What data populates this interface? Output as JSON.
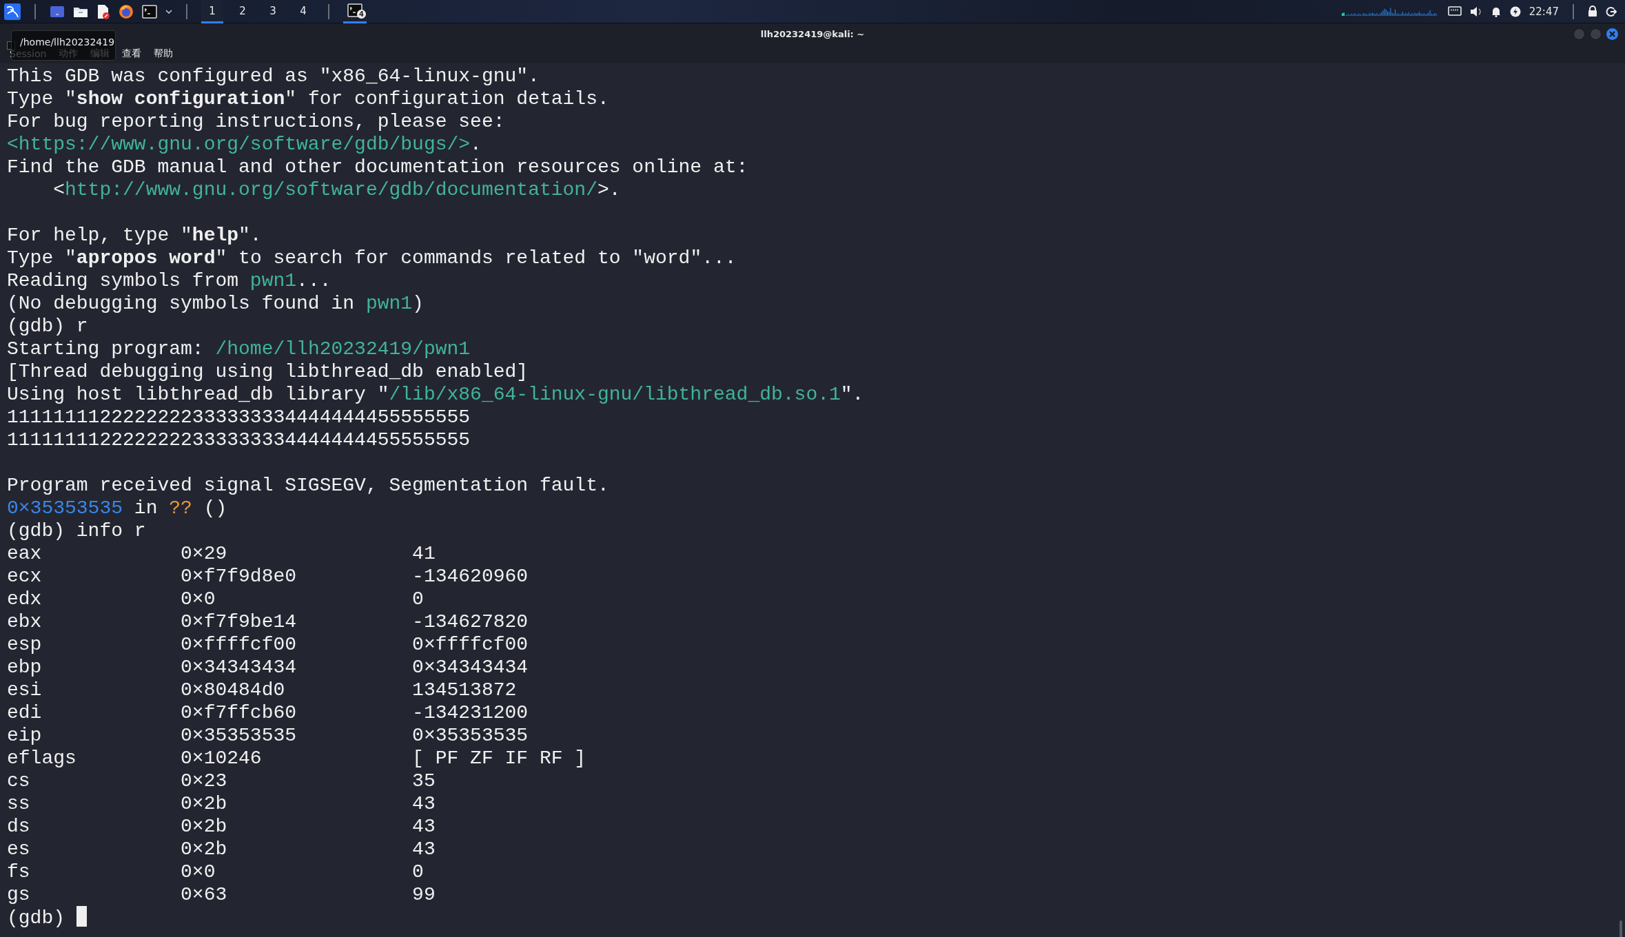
{
  "taskbar": {
    "workspaces": [
      {
        "label": "1",
        "selected": true
      },
      {
        "label": "2",
        "selected": false
      },
      {
        "label": "3",
        "selected": false
      },
      {
        "label": "4",
        "selected": false
      }
    ],
    "task": {
      "badge": "4",
      "selected": true
    },
    "clock": "22:47"
  },
  "window": {
    "title": "llh20232419@kali: ~",
    "tooltip": "/home/llh20232419",
    "menu": [
      "Session",
      "动作",
      "编辑",
      "查看",
      "帮助"
    ]
  },
  "terminal": {
    "lines": [
      {
        "kind": "text",
        "segments": [
          {
            "kind": "plain",
            "text": "This GDB was configured as \"x86_64-linux-gnu\"."
          }
        ]
      },
      {
        "kind": "text",
        "segments": [
          {
            "kind": "plain",
            "text": "Type \""
          },
          {
            "kind": "bold",
            "text": "show configuration"
          },
          {
            "kind": "plain",
            "text": "\" for configuration details."
          }
        ]
      },
      {
        "kind": "text",
        "segments": [
          {
            "kind": "plain",
            "text": "For bug reporting instructions, please see:"
          }
        ]
      },
      {
        "kind": "text",
        "segments": [
          {
            "kind": "url",
            "text": "<https://www.gnu.org/software/gdb/bugs/>"
          },
          {
            "kind": "plain",
            "text": "."
          }
        ]
      },
      {
        "kind": "text",
        "segments": [
          {
            "kind": "plain",
            "text": "Find the GDB manual and other documentation resources online at:"
          }
        ]
      },
      {
        "kind": "text",
        "segments": [
          {
            "kind": "plain",
            "text": "    <"
          },
          {
            "kind": "url",
            "text": "http://www.gnu.org/software/gdb/documentation/"
          },
          {
            "kind": "plain",
            "text": ">."
          }
        ]
      },
      {
        "kind": "blank"
      },
      {
        "kind": "text",
        "segments": [
          {
            "kind": "plain",
            "text": "For help, type \""
          },
          {
            "kind": "bold",
            "text": "help"
          },
          {
            "kind": "plain",
            "text": "\"."
          }
        ]
      },
      {
        "kind": "text",
        "segments": [
          {
            "kind": "plain",
            "text": "Type \""
          },
          {
            "kind": "bold",
            "text": "apropos word"
          },
          {
            "kind": "plain",
            "text": "\" to search for commands related to \"word\"..."
          }
        ]
      },
      {
        "kind": "text",
        "segments": [
          {
            "kind": "plain",
            "text": "Reading symbols from "
          },
          {
            "kind": "url",
            "text": "pwn1"
          },
          {
            "kind": "plain",
            "text": "..."
          }
        ]
      },
      {
        "kind": "text",
        "segments": [
          {
            "kind": "plain",
            "text": "(No debugging symbols found in "
          },
          {
            "kind": "url",
            "text": "pwn1"
          },
          {
            "kind": "plain",
            "text": ")"
          }
        ]
      },
      {
        "kind": "text",
        "segments": [
          {
            "kind": "plain",
            "text": "(gdb) r"
          }
        ]
      },
      {
        "kind": "text",
        "segments": [
          {
            "kind": "plain",
            "text": "Starting program: "
          },
          {
            "kind": "url",
            "text": "/home/llh20232419/pwn1"
          }
        ]
      },
      {
        "kind": "text",
        "segments": [
          {
            "kind": "plain",
            "text": "[Thread debugging using libthread_db enabled]"
          }
        ]
      },
      {
        "kind": "text",
        "segments": [
          {
            "kind": "plain",
            "text": "Using host libthread_db library \""
          },
          {
            "kind": "url",
            "text": "/lib/x86_64-linux-gnu/libthread_db.so.1"
          },
          {
            "kind": "plain",
            "text": "\"."
          }
        ]
      },
      {
        "kind": "text",
        "segments": [
          {
            "kind": "plain",
            "text": "1111111122222222333333334444444455555555"
          }
        ]
      },
      {
        "kind": "text",
        "segments": [
          {
            "kind": "plain",
            "text": "1111111122222222333333334444444455555555"
          }
        ]
      },
      {
        "kind": "blank"
      },
      {
        "kind": "text",
        "segments": [
          {
            "kind": "plain",
            "text": "Program received signal SIGSEGV, Segmentation fault."
          }
        ]
      },
      {
        "kind": "text",
        "segments": [
          {
            "kind": "address",
            "text": "0×35353535"
          },
          {
            "kind": "plain",
            "text": " in "
          },
          {
            "kind": "unknown",
            "text": "??"
          },
          {
            "kind": "plain",
            "text": " ()"
          }
        ]
      },
      {
        "kind": "text",
        "segments": [
          {
            "kind": "plain",
            "text": "(gdb) info r"
          }
        ]
      },
      {
        "kind": "register",
        "name": "eax",
        "hex": "0×29",
        "natural": "41"
      },
      {
        "kind": "register",
        "name": "ecx",
        "hex": "0×f7f9d8e0",
        "natural": "-134620960"
      },
      {
        "kind": "register",
        "name": "edx",
        "hex": "0×0",
        "natural": "0"
      },
      {
        "kind": "register",
        "name": "ebx",
        "hex": "0×f7f9be14",
        "natural": "-134627820"
      },
      {
        "kind": "register",
        "name": "esp",
        "hex": "0×ffffcf00",
        "natural": "0×ffffcf00"
      },
      {
        "kind": "register",
        "name": "ebp",
        "hex": "0×34343434",
        "natural": "0×34343434"
      },
      {
        "kind": "register",
        "name": "esi",
        "hex": "0×80484d0",
        "natural": "134513872"
      },
      {
        "kind": "register",
        "name": "edi",
        "hex": "0×f7ffcb60",
        "natural": "-134231200"
      },
      {
        "kind": "register",
        "name": "eip",
        "hex": "0×35353535",
        "natural": "0×35353535"
      },
      {
        "kind": "register",
        "name": "eflags",
        "hex": "0×10246",
        "natural": "[ PF ZF IF RF ]"
      },
      {
        "kind": "register",
        "name": "cs",
        "hex": "0×23",
        "natural": "35"
      },
      {
        "kind": "register",
        "name": "ss",
        "hex": "0×2b",
        "natural": "43"
      },
      {
        "kind": "register",
        "name": "ds",
        "hex": "0×2b",
        "natural": "43"
      },
      {
        "kind": "register",
        "name": "es",
        "hex": "0×2b",
        "natural": "43"
      },
      {
        "kind": "register",
        "name": "fs",
        "hex": "0×0",
        "natural": "0"
      },
      {
        "kind": "register",
        "name": "gs",
        "hex": "0×63",
        "natural": "99"
      },
      {
        "kind": "prompt",
        "text": "(gdb)"
      }
    ]
  }
}
